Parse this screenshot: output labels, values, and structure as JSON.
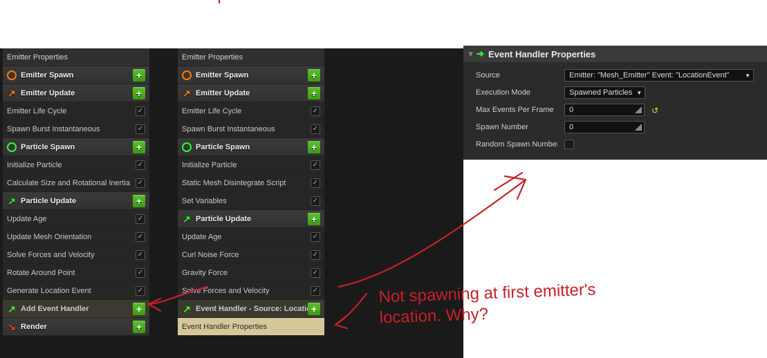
{
  "emitter1": {
    "header": "Emitter Properties",
    "sections": {
      "emitter_spawn": "Emitter Spawn",
      "emitter_update": "Emitter Update",
      "particle_spawn": "Particle Spawn",
      "particle_update": "Particle Update",
      "add_event_handler": "Add Event Handler",
      "render": "Render"
    },
    "modules": {
      "life_cycle": "Emitter Life Cycle",
      "spawn_burst": "Spawn Burst Instantaneous",
      "init_particle": "Initialize Particle",
      "calc_size": "Calculate Size and Rotational Inertia",
      "update_age": "Update Age",
      "update_mesh_orient": "Update Mesh Orientation",
      "solve_forces": "Solve Forces and Velocity",
      "rotate_around": "Rotate Around Point",
      "gen_loc_event": "Generate Location Event"
    }
  },
  "emitter2": {
    "header": "Emitter Properties",
    "sections": {
      "emitter_spawn": "Emitter Spawn",
      "emitter_update": "Emitter Update",
      "particle_spawn": "Particle Spawn",
      "particle_update": "Particle Update",
      "event_handler_src": "Event Handler - Source: Location"
    },
    "modules": {
      "life_cycle": "Emitter Life Cycle",
      "spawn_burst": "Spawn Burst Instantaneous",
      "init_particle": "Initialize Particle",
      "disintegrate": "Static Mesh Disintegrate Script",
      "set_vars": "Set Variables",
      "update_age": "Update Age",
      "curl_noise": "Curl Noise Force",
      "gravity": "Gravity Force",
      "solve_forces": "Solve Forces and Velocity",
      "evt_handler_props": "Event Handler Properties"
    }
  },
  "props": {
    "title": "Event Handler Properties",
    "source_label": "Source",
    "source_value": "Emitter: \"Mesh_Emitter\" Event: \"LocationEvent\"",
    "exec_mode_label": "Execution Mode",
    "exec_mode_value": "Spawned Particles",
    "max_events_label": "Max Events Per Frame",
    "max_events_value": "0",
    "spawn_number_label": "Spawn Number",
    "spawn_number_value": "0",
    "random_spawn_label": "Random Spawn Number"
  },
  "annotation": {
    "line1": "Not spawning at first emitter's",
    "line2": "location.  Why?"
  },
  "icons": {
    "plus": "+",
    "check": "✓",
    "arrow_ne": "↗",
    "arrow_sw": "↘"
  }
}
